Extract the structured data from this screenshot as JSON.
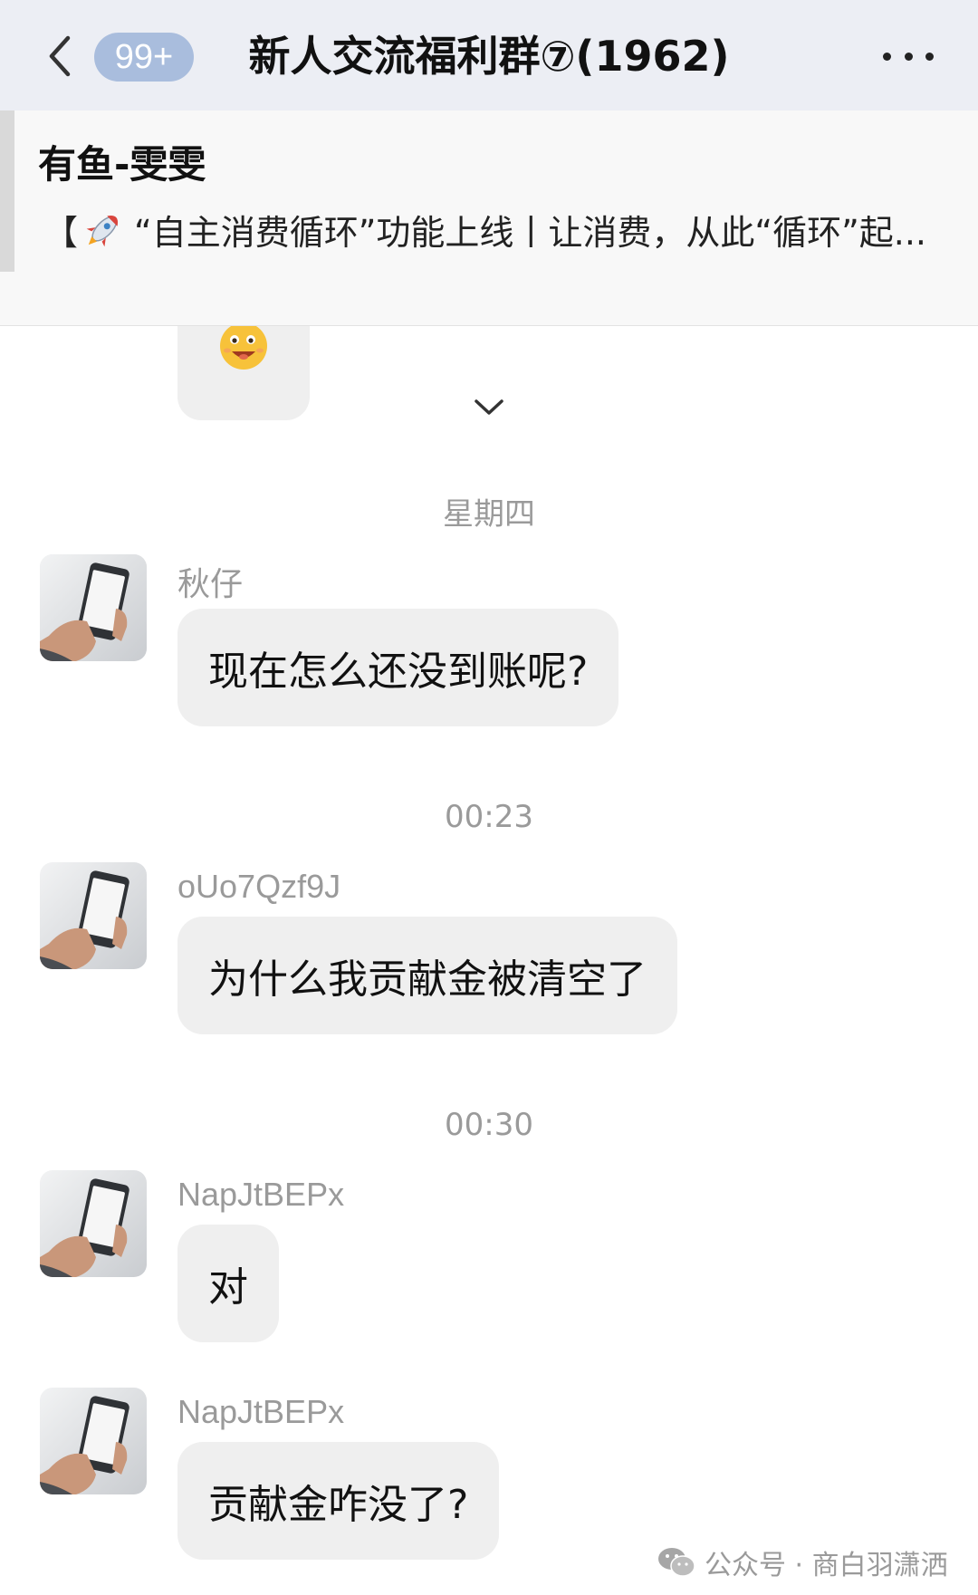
{
  "header": {
    "unread_count": "99+",
    "title": "新人交流福利群⑦(1962)"
  },
  "pinned": {
    "sender": "有鱼-雯雯",
    "text_prefix": "【",
    "text": "“自主消费循环”功能上线丨让消费，从此“循环”起..."
  },
  "messages": [
    {
      "time": "星期四",
      "sender": "秋仔",
      "text": "现在怎么还没到账呢?"
    },
    {
      "time": "00:23",
      "sender": "oUo7Qzf9J",
      "text": "为什么我贡献金被清空了"
    },
    {
      "time": "00:30",
      "sender": "NapJtBEPx",
      "text": "对"
    },
    {
      "time": "",
      "sender": "NapJtBEPx",
      "text": "贡献金咋没了?"
    }
  ],
  "watermark": {
    "text": "公众号 · 商白羽潇洒"
  },
  "icons": {
    "back": "chevron-left-icon",
    "more": "more-dots-icon",
    "expand": "chevron-down-icon",
    "rocket": "rocket-icon",
    "emoji": "smiley-emoji-icon",
    "avatar": "phone-in-hand-avatar",
    "wechat": "wechat-icon"
  },
  "colors": {
    "header_bg": "#eceef4",
    "badge_bg": "#a9bddd",
    "bubble_bg": "#efefef",
    "meta_text": "#9a9a9a"
  }
}
